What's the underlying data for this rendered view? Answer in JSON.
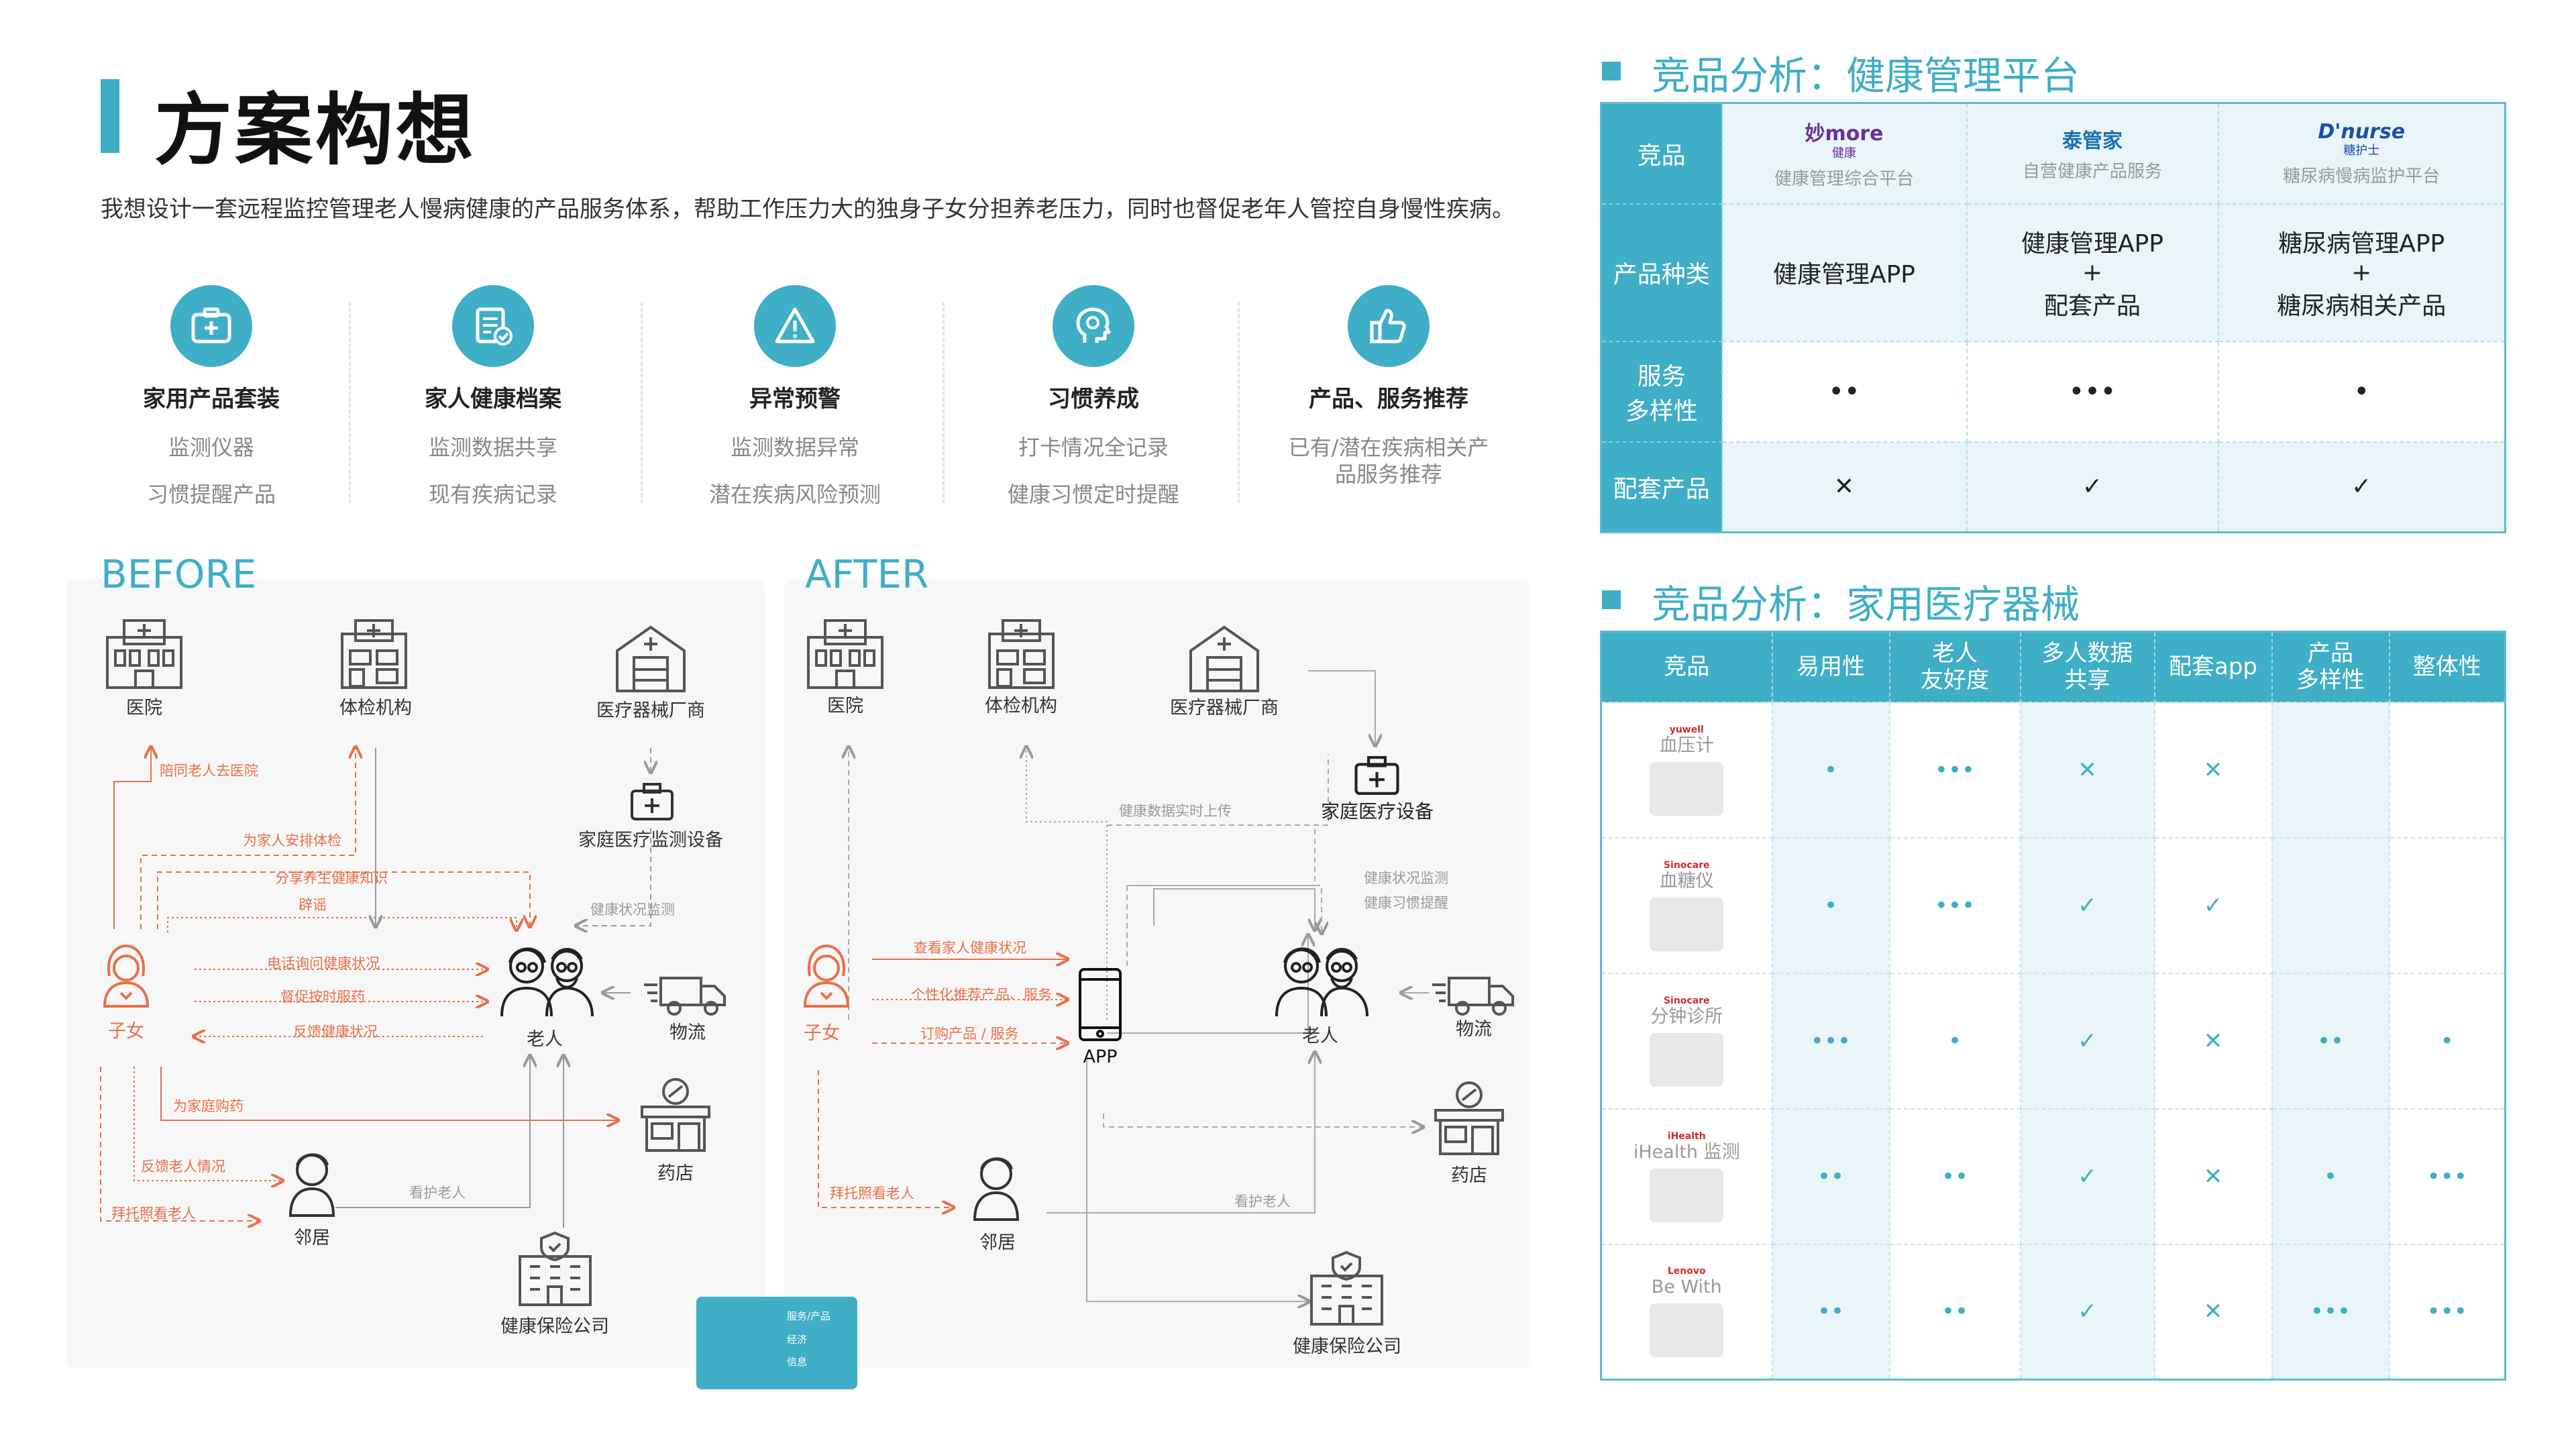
{
  "page": {
    "title": "方案构想",
    "intro": "我想设计一套远程监控管理老人慢病健康的产品服务体系，帮助工作压力大的独身子女分担养老压力，同时也督促老年人管控自身慢性疾病。"
  },
  "features": [
    {
      "icon": "medical-kit-icon",
      "title": "家用产品套装",
      "lines": [
        "监测仪器",
        "习惯提醒产品"
      ]
    },
    {
      "icon": "health-record-icon",
      "title": "家人健康档案",
      "lines": [
        "监测数据共享",
        "现有疾病记录"
      ]
    },
    {
      "icon": "warning-icon",
      "title": "异常预警",
      "lines": [
        "监测数据异常",
        "潜在疾病风险预测"
      ]
    },
    {
      "icon": "habit-head-icon",
      "title": "习惯养成",
      "lines": [
        "打卡情况全记录",
        "健康习惯定时提醒"
      ]
    },
    {
      "icon": "thumbs-up-icon",
      "title": "产品、服务推荐",
      "lines": [
        "已有/潜在疾病相关产品服务推荐"
      ]
    }
  ],
  "before": {
    "label": "BEFORE",
    "nodes": {
      "hospital": "医院",
      "checkup": "体检机构",
      "manufacturer": "医疗器械厂商",
      "home_device": "家庭医疗监测设备",
      "child": "子女",
      "elderly": "老人",
      "logistics": "物流",
      "pharmacy": "药店",
      "neighbor": "邻居",
      "insurance": "健康保险公司"
    },
    "annotations": {
      "a1": "陪同老人去医院",
      "a2": "为家人安排体检",
      "a3": "分享养生健康知识",
      "a4": "辟谣",
      "a5": "电话询问健康状况",
      "a6": "督促按时服药",
      "a7": "反馈健康状况",
      "a8": "为家庭购药",
      "a9": "反馈老人情况",
      "a10": "拜托照看老人",
      "a11": "看护老人",
      "a12": "健康状况监测"
    }
  },
  "after": {
    "label": "AFTER",
    "nodes": {
      "hospital": "医院",
      "checkup": "体检机构",
      "manufacturer": "医疗器械厂商",
      "home_device": "家庭医疗设备",
      "child": "子女",
      "app": "APP",
      "elderly": "老人",
      "logistics": "物流",
      "pharmacy": "药店",
      "neighbor": "邻居",
      "insurance": "健康保险公司"
    },
    "annotations": {
      "b1": "健康数据实时上传",
      "b2": "健康状况监测",
      "b3": "健康习惯提醒",
      "b4": "查看家人健康状况",
      "b5": "个性化推荐产品、服务",
      "b6": "订购产品 / 服务",
      "b7": "拜托照看老人",
      "b8": "看护老人"
    }
  },
  "legend": {
    "items": [
      "服务/产品",
      "经济",
      "信息"
    ]
  },
  "platform_analysis": {
    "title": "竞品分析：健康管理平台",
    "row_headers": [
      "竞品",
      "产品种类",
      "服务多样性",
      "配套产品"
    ],
    "row_headers_display": [
      "竞品",
      "产品种类",
      "服务\n多样性",
      "配套产品"
    ],
    "competitors": [
      {
        "logo": "妙more",
        "logo_sub": "健康",
        "desc": "健康管理综合平台",
        "types": [
          "健康管理APP"
        ],
        "diversity": "••",
        "accessory": "✕"
      },
      {
        "logo": "泰管家",
        "logo_sub": "",
        "desc": "自营健康产品服务",
        "types": [
          "健康管理APP",
          "+",
          "配套产品"
        ],
        "diversity": "•••",
        "accessory": "✓"
      },
      {
        "logo": "D'nurse",
        "logo_sub": "糖护士",
        "desc": "糖尿病慢病监护平台",
        "types": [
          "糖尿病管理APP",
          "+",
          "糖尿病相关产品"
        ],
        "diversity": "•",
        "accessory": "✓"
      }
    ]
  },
  "device_analysis": {
    "title": "竞品分析：家用医疗器械",
    "headers": [
      "竞品",
      "易用性",
      "老人\n友好度",
      "多人数据\n共享",
      "配套app",
      "产品\n多样性",
      "整体性"
    ],
    "rows": [
      {
        "brand": "yuwell",
        "name": "血压计",
        "cells": [
          "•",
          "•••",
          "✕",
          "✕",
          "",
          ""
        ]
      },
      {
        "brand": "Sinocare",
        "name": "血糖仪",
        "cells": [
          "•",
          "•••",
          "✓",
          "✓",
          "",
          ""
        ]
      },
      {
        "brand": "Sinocare",
        "name": "分钟诊所",
        "cells": [
          "•••",
          "•",
          "✓",
          "✕",
          "••",
          "•"
        ]
      },
      {
        "brand": "iHealth",
        "name": "iHealth 监测",
        "cells": [
          "••",
          "••",
          "✓",
          "✕",
          "•",
          "•••"
        ]
      },
      {
        "brand": "Lenovo",
        "name": "Be With",
        "cells": [
          "••",
          "••",
          "✓",
          "✕",
          "•••",
          "•••"
        ]
      }
    ]
  },
  "colors": {
    "accent": "#3faec7",
    "orange": "#e8704a",
    "gray": "#999999"
  }
}
